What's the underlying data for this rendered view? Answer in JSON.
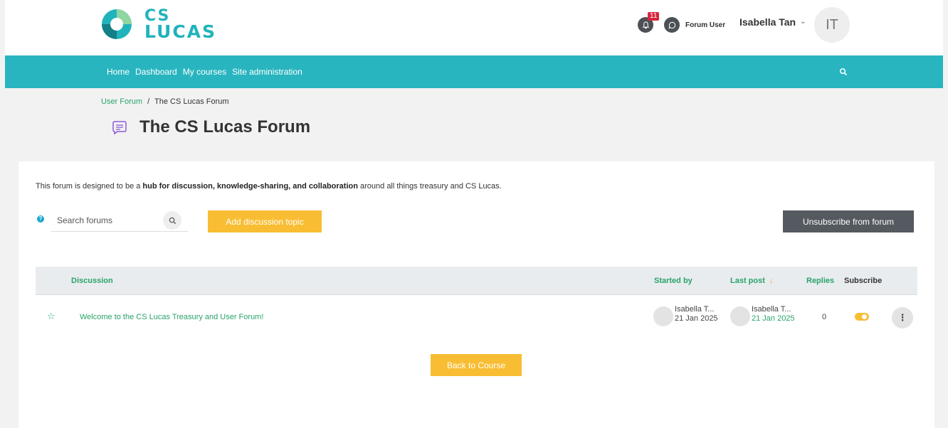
{
  "brand": {
    "logo_line1": "CS",
    "logo_line2": "LUCAS",
    "accent": "#29b5bf",
    "green": "#29a36a",
    "yellow": "#f8bd32"
  },
  "header": {
    "notification_count": "11",
    "forum_user_label": "Forum User",
    "user_name": "Isabella Tan",
    "avatar_initials": "IT"
  },
  "nav": {
    "items": [
      "Home",
      "Dashboard",
      "My courses",
      "Site administration"
    ]
  },
  "breadcrumb": {
    "parent": "User Forum",
    "separator": "/",
    "current": "The CS Lucas Forum"
  },
  "page": {
    "title": "The CS Lucas Forum"
  },
  "intro": {
    "before": "This forum is designed to be a ",
    "bold": "hub for discussion, knowledge-sharing, and collaboration",
    "after": " around all things treasury and CS Lucas."
  },
  "toolbar": {
    "help_glyph": "?",
    "search_placeholder": "Search forums",
    "add_label": "Add discussion topic",
    "unsubscribe_label": "Unsubscribe from forum"
  },
  "table": {
    "headers": {
      "discussion": "Discussion",
      "started_by": "Started by",
      "last_post": "Last post",
      "replies": "Replies",
      "subscribe": "Subscribe"
    },
    "rows": [
      {
        "topic": "Welcome to the CS Lucas Treasury and User Forum!",
        "started_by_name": "Isabella T...",
        "started_by_date": "21 Jan 2025",
        "last_post_name": "Isabella T...",
        "last_post_date": "21 Jan 2025",
        "replies": "0",
        "subscribed": true
      }
    ]
  },
  "footer": {
    "back_label": "Back to Course"
  }
}
